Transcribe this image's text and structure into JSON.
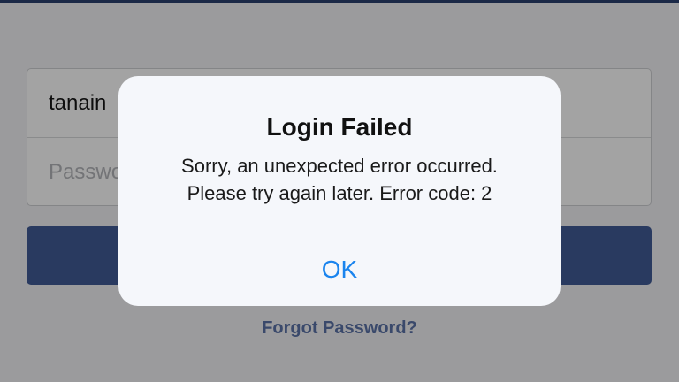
{
  "login_form": {
    "username_value": "tanain",
    "password_placeholder": "Password"
  },
  "forgot_password": "Forgot Password?",
  "alert": {
    "title": "Login Failed",
    "message_line1": "Sorry, an unexpected error occurred.",
    "message_line2": "Please try again later. Error code: 2",
    "ok_button": "OK"
  },
  "colors": {
    "accent_blue": "#1a84ee",
    "login_button": "#415b96",
    "link_color": "#5b73a8"
  }
}
